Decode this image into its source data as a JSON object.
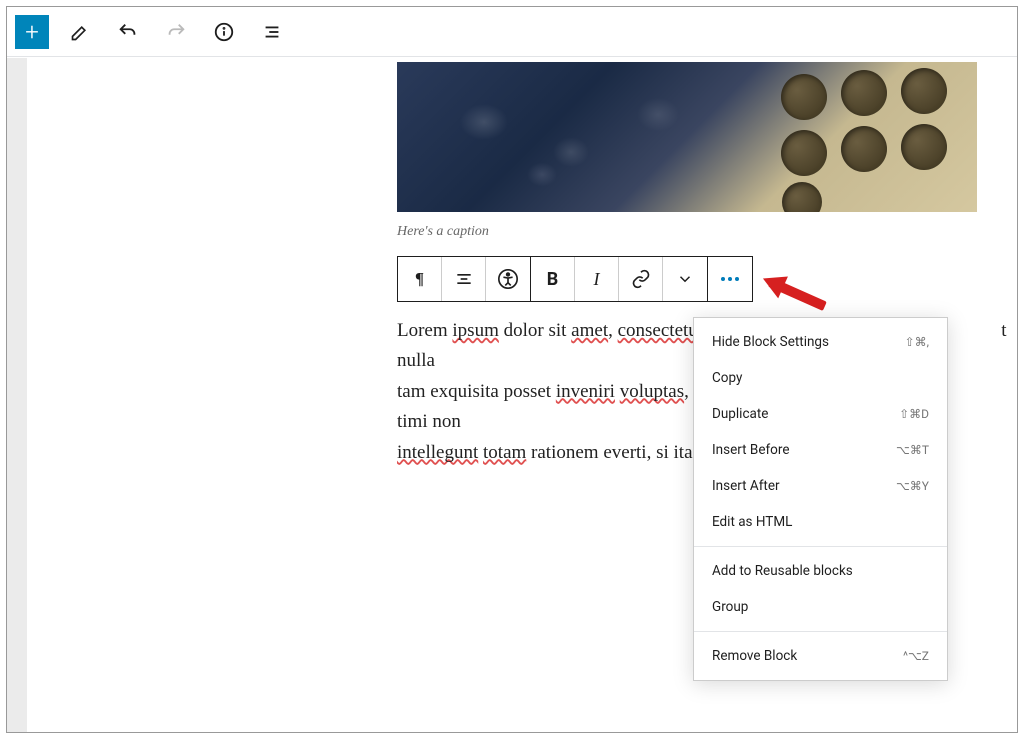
{
  "topbar": {
    "add_icon": "+",
    "tools": [
      "pencil",
      "undo",
      "redo",
      "info",
      "outline"
    ]
  },
  "image": {
    "caption": "Here's a caption"
  },
  "block_toolbar": {
    "items": [
      "paragraph",
      "align",
      "accessibility",
      "bold",
      "italic",
      "link",
      "chevron",
      "more"
    ]
  },
  "paragraph": {
    "text_plain": "Lorem ipsum dolor sit amet, consectetur adipiscing elit, quid est, quod in hac causa maxime homines admirentur et nulla tam exquisita posset inveniri voluptas, timi non intellegunt totam rationem everti, si ita"
  },
  "dropdown": {
    "groups": [
      [
        {
          "label": "Hide Block Settings",
          "shortcut": "⇧⌘,"
        },
        {
          "label": "Copy",
          "shortcut": ""
        },
        {
          "label": "Duplicate",
          "shortcut": "⇧⌘D"
        },
        {
          "label": "Insert Before",
          "shortcut": "⌥⌘T"
        },
        {
          "label": "Insert After",
          "shortcut": "⌥⌘Y"
        },
        {
          "label": "Edit as HTML",
          "shortcut": ""
        }
      ],
      [
        {
          "label": "Add to Reusable blocks",
          "shortcut": ""
        },
        {
          "label": "Group",
          "shortcut": ""
        }
      ],
      [
        {
          "label": "Remove Block",
          "shortcut": "^⌥Z"
        }
      ]
    ]
  }
}
